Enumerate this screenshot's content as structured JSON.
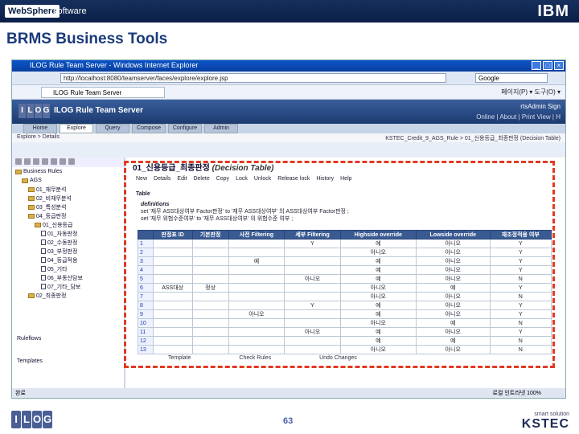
{
  "header": {
    "websphere": "WebSphere",
    "software": "software",
    "ibm": "IBM"
  },
  "slide": {
    "title": "BRMS Business Tools",
    "page": "63"
  },
  "browser": {
    "title": "ILOG Rule Team Server - Windows Internet Explorer",
    "address": "http://localhost:8080/teamserver/faces/explore/explore.jsp",
    "search": "Google",
    "tab": "ILOG Rule Team Server",
    "tools": "페이지(P) ▾   도구(O) ▾",
    "status_left": "완료",
    "status_right": "로컬 인트라넷",
    "zoom": "100%"
  },
  "app": {
    "name": "ILOG Rule Team Server",
    "user": "rtsAdmin Sign",
    "links": "Online | About | Print View | H",
    "tabs": [
      "Home",
      "Explore",
      "Query",
      "Compose",
      "Configure",
      "Admin"
    ],
    "breadcrumb": "Explore > Details",
    "breadcrumb_right": "KSTEC_Credit_9_AGS_Rule > 01_신용등급_최종판정 (Decision Table)"
  },
  "tree": {
    "root": "Business Rules",
    "nodes": [
      "AGS",
      "01_재무분석",
      "02_비재무분석",
      "03_특성분석",
      "04_등급판정",
      "01_신용등급",
      "01_자동판정",
      "02_수동판정",
      "03_부정판정",
      "04_등급적용",
      "05_기타",
      "06_부동산담보",
      "07_기타_담보",
      "02_최종판정"
    ],
    "rules": "Ruleflows",
    "templates": "Templates"
  },
  "content": {
    "title": "01_신용등급_최종판정",
    "title_type": "(Decision Table)",
    "toolbar": [
      "New",
      "Details",
      "Edit",
      "Delete",
      "Copy",
      "Lock",
      "Unlock",
      "Release lock",
      "History",
      "Help"
    ],
    "section": "Table",
    "definitions_label": "definitions",
    "def1": "set '재무 ASS대상여부 Factor판정' to '재무 ASS대상여부' 의 ASS대상여부 Factor판정 ;",
    "def2": "set '재무 위험수준여부' to '재무 ASS대상여부' 의 위험수준 여부 ;",
    "bottom_labels": [
      "Template",
      "Check Rules",
      "Undo Changes"
    ]
  },
  "table": {
    "headers": [
      "",
      "판정표 ID",
      "기본판정",
      "사전 Filtering",
      "세부 Filtering",
      "Highside override",
      "Lowside override",
      "재조정적용 여부"
    ],
    "rows": [
      [
        "1",
        "",
        "",
        "",
        "Y",
        "예",
        "아니오",
        "Y"
      ],
      [
        "2",
        "",
        "",
        "",
        "",
        "아니오",
        "아니오",
        "Y"
      ],
      [
        "3",
        "",
        "",
        "예",
        "",
        "예",
        "아니오",
        "Y"
      ],
      [
        "4",
        "",
        "",
        "",
        "",
        "예",
        "아니오",
        "Y"
      ],
      [
        "5",
        "",
        "",
        "",
        "아니오",
        "예",
        "아니오",
        "N"
      ],
      [
        "6",
        "ASS대상",
        "정상",
        "",
        "",
        "아니오",
        "예",
        "Y"
      ],
      [
        "7",
        "",
        "",
        "",
        "",
        "아니오",
        "아니오",
        "N"
      ],
      [
        "8",
        "",
        "",
        "",
        "Y",
        "예",
        "아니오",
        "Y"
      ],
      [
        "9",
        "",
        "",
        "아니오",
        "",
        "예",
        "아니오",
        "Y"
      ],
      [
        "10",
        "",
        "",
        "",
        "",
        "아니오",
        "예",
        "N"
      ],
      [
        "11",
        "",
        "",
        "",
        "아니오",
        "예",
        "아니오",
        "Y"
      ],
      [
        "12",
        "",
        "",
        "",
        "",
        "예",
        "예",
        "N"
      ],
      [
        "13",
        "",
        "",
        "",
        "",
        "아니오",
        "아니오",
        "N"
      ]
    ]
  },
  "footer": {
    "solution": "smart solution",
    "brand": "KSTEC",
    "ilog": [
      "I",
      "L",
      "O",
      "G"
    ]
  }
}
